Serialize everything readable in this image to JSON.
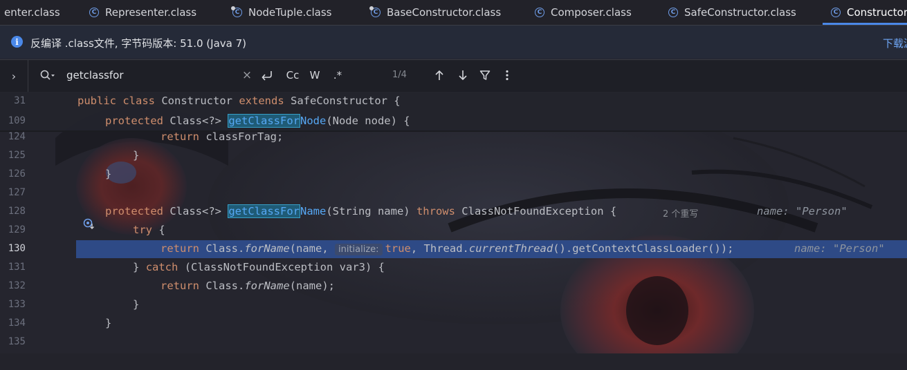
{
  "tabs": [
    {
      "label": "enter.class",
      "modified": false,
      "active": false
    },
    {
      "label": "Representer.class",
      "modified": false,
      "active": false
    },
    {
      "label": "NodeTuple.class",
      "modified": true,
      "active": false
    },
    {
      "label": "BaseConstructor.class",
      "modified": true,
      "active": false
    },
    {
      "label": "Composer.class",
      "modified": false,
      "active": false
    },
    {
      "label": "SafeConstructor.class",
      "modified": false,
      "active": false
    },
    {
      "label": "Constructor",
      "modified": false,
      "active": true
    }
  ],
  "banner": {
    "text": "反编译 .class文件, 字节码版本: 51.0 (Java 7)",
    "link": "下载源"
  },
  "search": {
    "query": "getclassfor",
    "match_count": "1/4",
    "case_label": "Cc",
    "word_label": "W",
    "regex_label": ".*"
  },
  "editor": {
    "sticky": [
      {
        "num": "31",
        "c0": "public",
        "c1": " ",
        "c2": "class",
        "c3": " Constructor ",
        "c4": "extends",
        "c5": " SafeConstructor {"
      },
      {
        "num": "109",
        "c0": "protected",
        "c1": " Class<?> ",
        "c2": "getClassFor",
        "c3": "Node",
        "c4": "(Node node) {"
      }
    ],
    "lines": [
      {
        "num": "124",
        "c0": "return",
        "c1": " classForTag;"
      },
      {
        "num": "125",
        "c0": "}"
      },
      {
        "num": "126",
        "c0": "}"
      },
      {
        "num": "127"
      },
      {
        "num": "128",
        "c0": "protected",
        "c1": " Class<?> ",
        "c2": "getClassFor",
        "c3": "Name",
        "c4": "(String name) ",
        "c5": "throws",
        "c6": " ClassNotFoundException {",
        "usages": "2 个重写",
        "debug": "name: \"Person\""
      },
      {
        "num": "129",
        "c0": "try",
        "c1": " {"
      },
      {
        "num": "130",
        "c0": "return",
        "c1": " Class.",
        "c2": "forName",
        "c3": "(name, ",
        "hint": "initialize:",
        "c4": "true",
        "c5": ", Thread.",
        "c6": "currentThread",
        "c7": "().getContextClassLoader());",
        "debug": "name: \"Person\""
      },
      {
        "num": "131",
        "c0": "}",
        "c1": " ",
        "c2": "catch",
        "c3": " (ClassNotFoundException var3) {"
      },
      {
        "num": "132",
        "c0": "return",
        "c1": " Class.",
        "c2": "forName",
        "c3": "(name);"
      },
      {
        "num": "133",
        "c0": "}"
      },
      {
        "num": "134",
        "c0": "}"
      },
      {
        "num": "135"
      }
    ]
  },
  "colors": {
    "keyword": "#cf8e6d",
    "function": "#56a8f5",
    "accent": "#4a88e8",
    "current_line": "#2e4a86"
  }
}
